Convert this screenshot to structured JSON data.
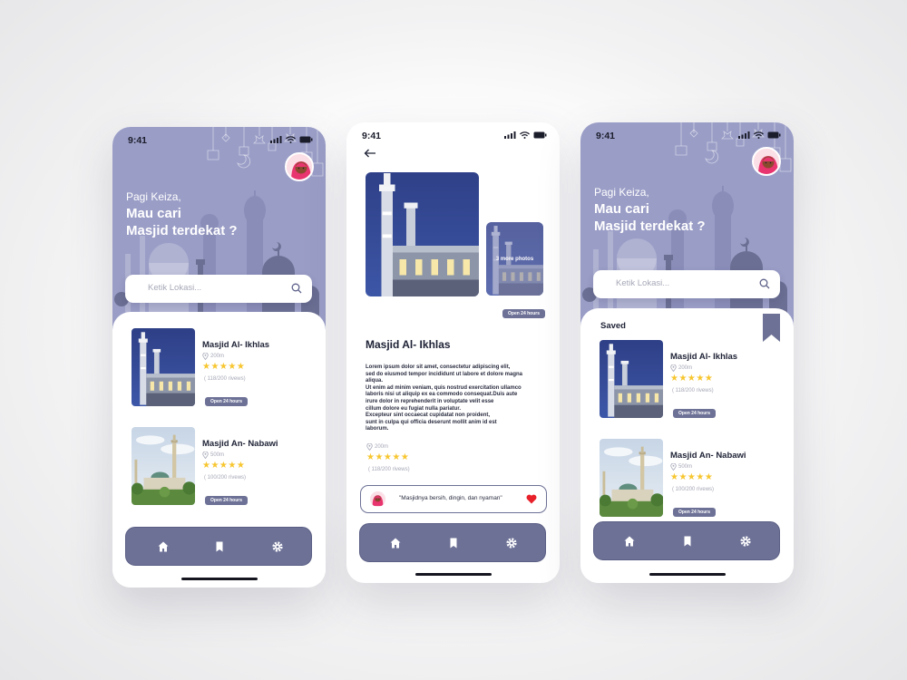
{
  "colors": {
    "hero": "#9a9dc6",
    "nav": "#6d7196",
    "accent": "#f7c62f",
    "heart": "#e8202a"
  },
  "status": {
    "time": "9:41"
  },
  "home_screen": {
    "greeting_small": "Pagi Keiza,",
    "greeting_line1": "Mau cari",
    "greeting_line2": "Masjid terdekat ?",
    "search_placeholder": "Ketik Lokasi...",
    "mosques": [
      {
        "name": "Masjid Al- Ikhlas",
        "distance": "200m",
        "stars": "★★★★★",
        "reviews": "( 118/200 rivews)",
        "badge": "Open 24 hours"
      },
      {
        "name": "Masjid An- Nabawi",
        "distance": "500m",
        "stars": "★★★★★",
        "reviews": "( 100/200 rivews)",
        "badge": "Open 24 hours"
      }
    ]
  },
  "detail_screen": {
    "more_photos": "3 more photos",
    "badge": "Open 24 hours",
    "title": "Masjid Al- Ikhlas",
    "description": [
      "Lorem ipsum dolor sit amet, consectetur adipiscing elit,",
      "sed do eiusmod tempor incididunt ut labore et dolore magna",
      "aliqua.",
      "Ut enim ad minim veniam, quis nostrud exercitation ullamco",
      "laboris nisi ut aliquip ex ea commodo consequat.Duis aute",
      "irure dolor in reprehenderit in voluptate velit esse",
      "cillum dolore eu fugiat nulla pariatur.",
      "Excepteur sint occaecat cupidatat non proident,",
      "sunt in culpa qui officia deserunt mollit anim id est",
      "laborum."
    ],
    "distance": "200m",
    "stars": "★★★★★",
    "reviews": "( 118/200 rivews)",
    "review_quote": "\"Masjidnya bersih, dingin, dan nyaman\""
  },
  "saved_screen": {
    "greeting_small": "Pagi Keiza,",
    "greeting_line1": "Mau cari",
    "greeting_line2": "Masjid terdekat ?",
    "search_placeholder": "Ketik Lokasi...",
    "section_title": "Saved",
    "mosques": [
      {
        "name": "Masjid Al- Ikhlas",
        "distance": "200m",
        "stars": "★★★★★",
        "reviews": "( 118/200 rivews)",
        "badge": "Open 24 hours"
      },
      {
        "name": "Masjid An- Nabawi",
        "distance": "500m",
        "stars": "★★★★★",
        "reviews": "( 100/200 rivews)",
        "badge": "Open 24 hours"
      }
    ]
  },
  "icons": {
    "nav": [
      "home-icon",
      "bookmark-icon",
      "gear-icon"
    ],
    "back": "arrow-left-icon",
    "search": "search-icon",
    "pin": "location-pin-icon",
    "heart": "heart-icon"
  }
}
